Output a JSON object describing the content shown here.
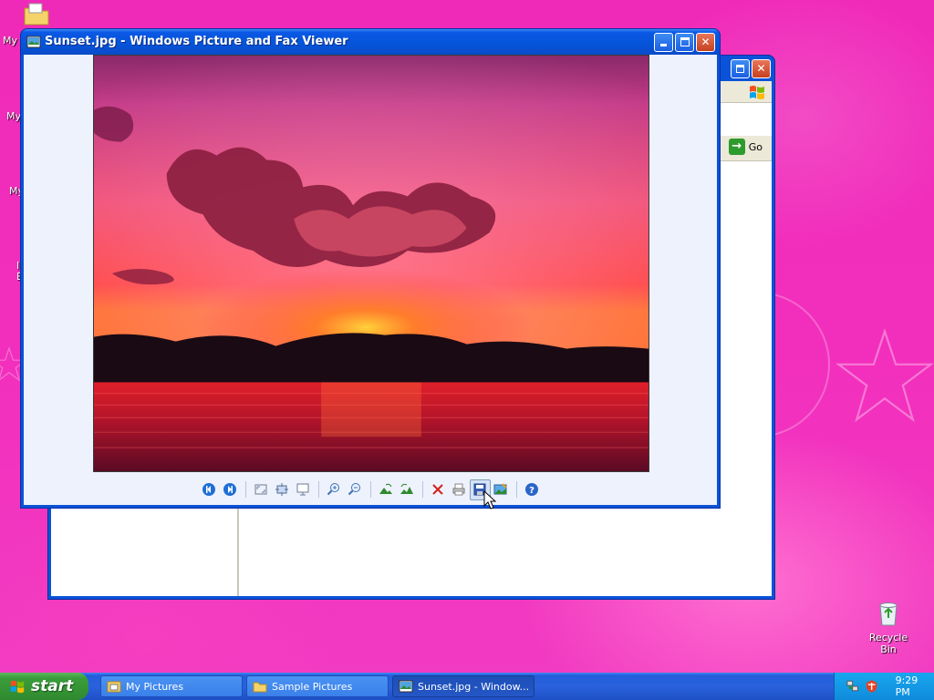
{
  "desktop": {
    "icons_partial": [
      "My D",
      "My",
      "My",
      "I",
      "E"
    ],
    "recycle_bin_label": "Recycle Bin"
  },
  "explorer_bg": {
    "go_label": "Go"
  },
  "viewer": {
    "title": "Sunset.jpg - Windows Picture and Fax Viewer",
    "toolbar_icons": [
      "previous-image-icon",
      "next-image-icon",
      "best-fit-icon",
      "actual-size-icon",
      "slideshow-icon",
      "zoom-in-icon",
      "zoom-out-icon",
      "rotate-clockwise-icon",
      "rotate-counterclockwise-icon",
      "delete-icon",
      "print-icon",
      "save-copy-icon",
      "open-for-editing-icon",
      "help-icon"
    ]
  },
  "taskbar": {
    "start_label": "start",
    "items": [
      {
        "label": "My Pictures",
        "active": false
      },
      {
        "label": "Sample Pictures",
        "active": false
      },
      {
        "label": "Sunset.jpg - Window...",
        "active": true
      }
    ],
    "clock": "9:29 PM"
  },
  "colors": {
    "wallpaper": "#ef2ab8",
    "titlebar": "#0554d8",
    "taskbar": "#245edb",
    "start_green": "#3a9d3a"
  }
}
